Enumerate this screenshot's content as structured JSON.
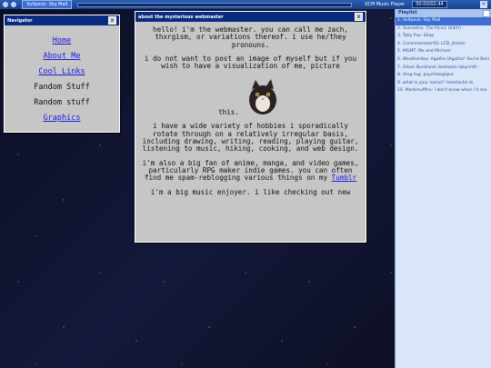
{
  "player": {
    "track": "Vulfpeck- Sky Mall",
    "title": "SCM Music Player",
    "time": "00:00/02:44"
  },
  "nav": {
    "title": "Navigator",
    "close": "x",
    "items": [
      {
        "label": "Home",
        "link": true
      },
      {
        "label": "About Me",
        "link": true
      },
      {
        "label": "Cool Links",
        "link": true
      },
      {
        "label": "Fandom Stuff",
        "link": false
      },
      {
        "label": "Random stuff",
        "link": false
      },
      {
        "label": "Graphics",
        "link": true
      }
    ]
  },
  "main": {
    "title": "about the mysterious webmaster",
    "close": "x",
    "p1": "hello! i'm the webmaster. you can call me zach, thxrgism, or variations thereof. i use he/they pronouns.",
    "p2": "i do not want to post an image of myself but if you wish to have a visualization of me, picture",
    "p2_after": "this.",
    "p3": "i have a wide variety of hobbies i sporadically rotate through on a relatively irregular basis, including drawing, writing, reading, playing guitar, listening to music, hiking, cooking, and web design.",
    "p4": "i'm also a big fan of anime, manga, and video games, particularly RPG maker indie games. you can often find me spam-reblogging various things on my",
    "p4_link": "Tumblr",
    "p5": "i'm a big music enjoyer. i like checking out new"
  },
  "playlist": {
    "title": "Playlist",
    "items": [
      "1. Vulfpeck- Sky Mall",
      "2. Sunsasha- The Picnic (Edit!)",
      "3. Toby Fox- Shop",
      "4. Cocknmonster93- LCD_dream",
      "5. MGMT- Me and Michael",
      "6. Weatherday- Agatha (Agatha! You're Bein",
      "7. Oliver Buckland- bedroom labyrinth",
      "8. drug tug- psychologique",
      "9. what is your name?- heartache st.",
      "10. Marbmuffins- i don't know when i'll see"
    ]
  },
  "colors": {
    "title_bar": "#0b2a82",
    "window_bg": "#c6c6c6",
    "link": "#1a1ae0",
    "playlist_bg": "#d9e6f8",
    "active_track": "#3d6fd0"
  }
}
